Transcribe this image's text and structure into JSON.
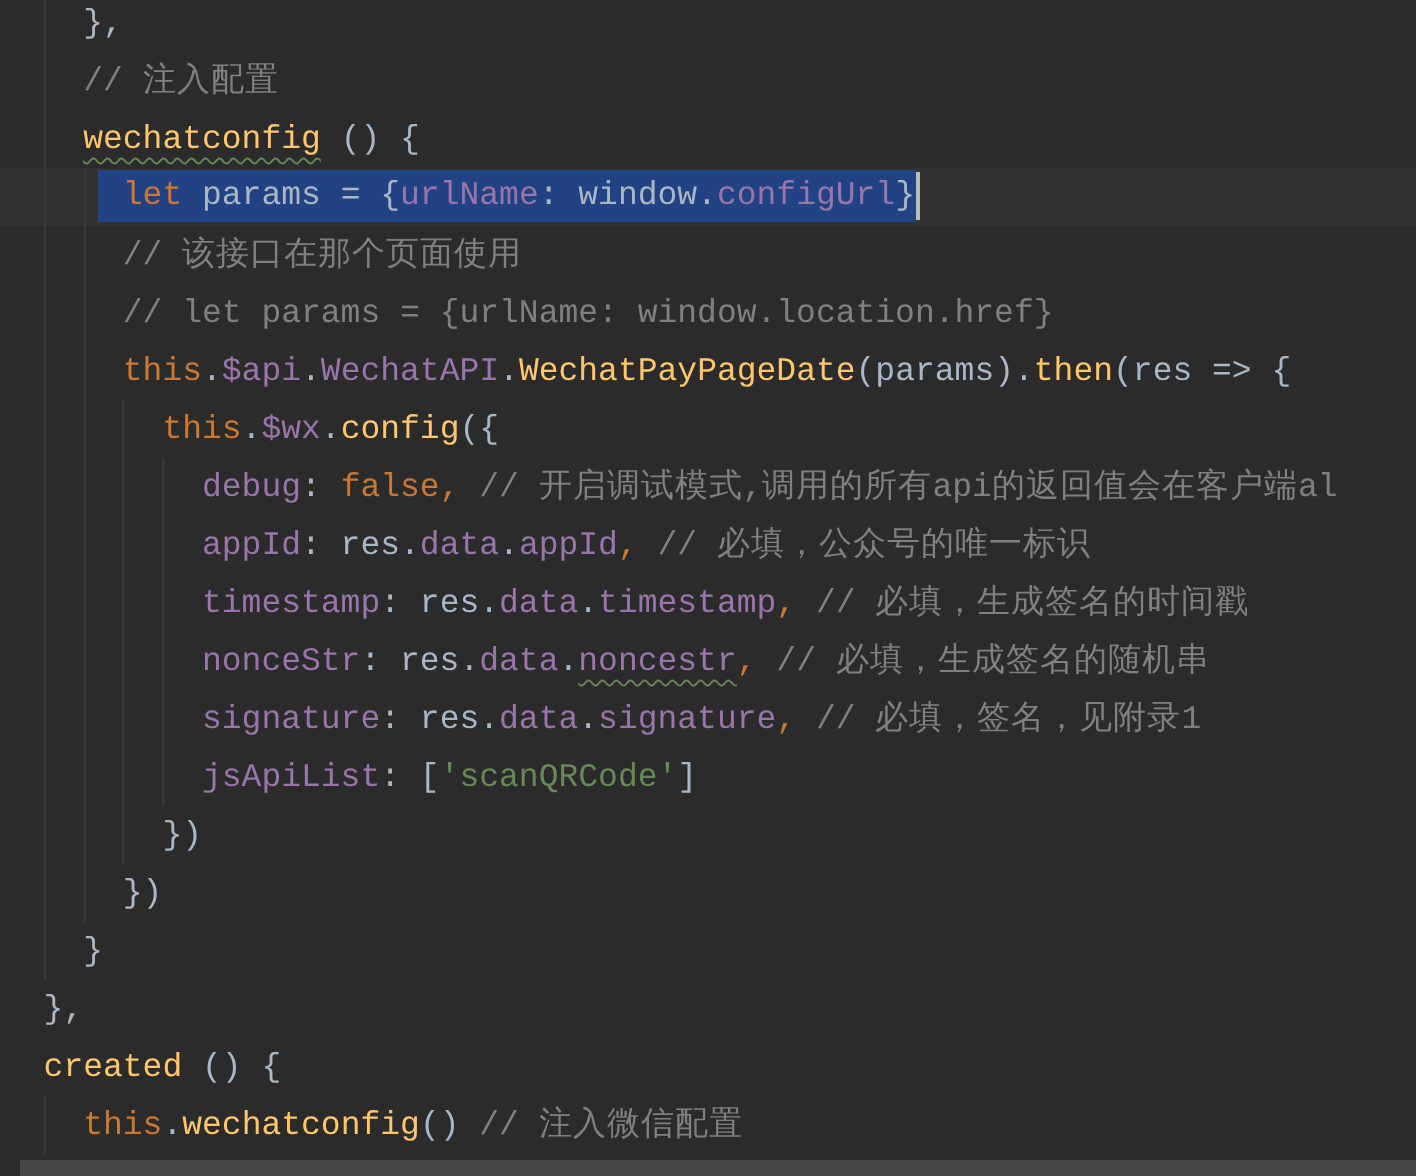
{
  "editor": {
    "lines": [
      {
        "children": [
          {
            "current": false,
            "selected": false,
            "tokens": [
              {
                "text": "},",
                "kind": "plain"
              }
            ]
          },
          {
            "current": false,
            "selected": false,
            "tokens": [
              {
                "text": "// 注入配置",
                "kind": "comment"
              }
            ]
          },
          {
            "current": false,
            "selected": false,
            "tokens": [
              {
                "text": "wechatconfig",
                "kind": "method",
                "misspelled": true
              },
              {
                "text": " () {",
                "kind": "plain"
              }
            ],
            "children": [
              {
                "current": true,
                "selected": true,
                "tokens": [
                  {
                    "text": "let",
                    "kind": "keyword"
                  },
                  {
                    "text": " params = {",
                    "kind": "plain"
                  },
                  {
                    "text": "urlName",
                    "kind": "property"
                  },
                  {
                    "text": ": window.",
                    "kind": "plain"
                  },
                  {
                    "text": "configUrl",
                    "kind": "property"
                  },
                  {
                    "text": "}",
                    "kind": "plain"
                  }
                ]
              },
              {
                "current": false,
                "selected": false,
                "tokens": [
                  {
                    "text": "// 该接口在那个页面使用",
                    "kind": "comment"
                  }
                ]
              },
              {
                "current": false,
                "selected": false,
                "tokens": [
                  {
                    "text": "// let params = {urlName: window.location.href}",
                    "kind": "comment"
                  }
                ]
              },
              {
                "current": false,
                "selected": false,
                "tokens": [
                  {
                    "text": "this",
                    "kind": "keyword"
                  },
                  {
                    "text": ".",
                    "kind": "plain"
                  },
                  {
                    "text": "$api",
                    "kind": "property"
                  },
                  {
                    "text": ".",
                    "kind": "plain"
                  },
                  {
                    "text": "WechatAPI",
                    "kind": "property"
                  },
                  {
                    "text": ".",
                    "kind": "plain"
                  },
                  {
                    "text": "WechatPayPageDate",
                    "kind": "method"
                  },
                  {
                    "text": "(params).",
                    "kind": "plain"
                  },
                  {
                    "text": "then",
                    "kind": "method"
                  },
                  {
                    "text": "(res => {",
                    "kind": "plain"
                  }
                ],
                "children": [
                  {
                    "current": false,
                    "selected": false,
                    "tokens": [
                      {
                        "text": "this",
                        "kind": "keyword"
                      },
                      {
                        "text": ".",
                        "kind": "plain"
                      },
                      {
                        "text": "$wx",
                        "kind": "property"
                      },
                      {
                        "text": ".",
                        "kind": "plain"
                      },
                      {
                        "text": "config",
                        "kind": "method"
                      },
                      {
                        "text": "({",
                        "kind": "plain"
                      }
                    ],
                    "children": [
                      {
                        "current": false,
                        "selected": false,
                        "tokens": [
                          {
                            "text": "debug",
                            "kind": "property"
                          },
                          {
                            "text": ": ",
                            "kind": "plain"
                          },
                          {
                            "text": "false",
                            "kind": "keyword"
                          },
                          {
                            "text": ", ",
                            "kind": "keyword"
                          },
                          {
                            "text": "// 开启调试模式,调用的所有api的返回值会在客户端al",
                            "kind": "comment"
                          }
                        ]
                      },
                      {
                        "current": false,
                        "selected": false,
                        "tokens": [
                          {
                            "text": "appId",
                            "kind": "property"
                          },
                          {
                            "text": ": res.",
                            "kind": "plain"
                          },
                          {
                            "text": "data",
                            "kind": "property"
                          },
                          {
                            "text": ".",
                            "kind": "plain"
                          },
                          {
                            "text": "appId",
                            "kind": "property"
                          },
                          {
                            "text": ", ",
                            "kind": "keyword"
                          },
                          {
                            "text": "// 必填，公众号的唯一标识",
                            "kind": "comment"
                          }
                        ]
                      },
                      {
                        "current": false,
                        "selected": false,
                        "tokens": [
                          {
                            "text": "timestamp",
                            "kind": "property"
                          },
                          {
                            "text": ": res.",
                            "kind": "plain"
                          },
                          {
                            "text": "data",
                            "kind": "property"
                          },
                          {
                            "text": ".",
                            "kind": "plain"
                          },
                          {
                            "text": "timestamp",
                            "kind": "property"
                          },
                          {
                            "text": ", ",
                            "kind": "keyword"
                          },
                          {
                            "text": "// 必填，生成签名的时间戳",
                            "kind": "comment"
                          }
                        ]
                      },
                      {
                        "current": false,
                        "selected": false,
                        "tokens": [
                          {
                            "text": "nonceStr",
                            "kind": "property"
                          },
                          {
                            "text": ": res.",
                            "kind": "plain"
                          },
                          {
                            "text": "data",
                            "kind": "property"
                          },
                          {
                            "text": ".",
                            "kind": "plain"
                          },
                          {
                            "text": "noncestr",
                            "kind": "property",
                            "misspelled": true
                          },
                          {
                            "text": ", ",
                            "kind": "keyword"
                          },
                          {
                            "text": "// 必填，生成签名的随机串",
                            "kind": "comment"
                          }
                        ]
                      },
                      {
                        "current": false,
                        "selected": false,
                        "tokens": [
                          {
                            "text": "signature",
                            "kind": "property"
                          },
                          {
                            "text": ": res.",
                            "kind": "plain"
                          },
                          {
                            "text": "data",
                            "kind": "property"
                          },
                          {
                            "text": ".",
                            "kind": "plain"
                          },
                          {
                            "text": "signature",
                            "kind": "property"
                          },
                          {
                            "text": ", ",
                            "kind": "keyword"
                          },
                          {
                            "text": "// 必填，签名，见附录1",
                            "kind": "comment"
                          }
                        ]
                      },
                      {
                        "current": false,
                        "selected": false,
                        "tokens": [
                          {
                            "text": "jsApiList",
                            "kind": "property"
                          },
                          {
                            "text": ": [",
                            "kind": "plain"
                          },
                          {
                            "text": "'scanQRCode'",
                            "kind": "string"
                          },
                          {
                            "text": "]",
                            "kind": "plain"
                          }
                        ]
                      }
                    ]
                  },
                  {
                    "current": false,
                    "selected": false,
                    "tokens": [
                      {
                        "text": "})",
                        "kind": "plain"
                      }
                    ]
                  }
                ]
              },
              {
                "current": false,
                "selected": false,
                "tokens": [
                  {
                    "text": "})",
                    "kind": "plain"
                  }
                ]
              }
            ]
          },
          {
            "current": false,
            "selected": false,
            "tokens": [
              {
                "text": "}",
                "kind": "plain"
              }
            ]
          }
        ]
      },
      {
        "current": false,
        "selected": false,
        "tokens": [
          {
            "text": "},",
            "kind": "plain"
          }
        ]
      },
      {
        "current": false,
        "selected": false,
        "tokens": [
          {
            "text": "created",
            "kind": "method"
          },
          {
            "text": " () {",
            "kind": "plain"
          }
        ],
        "children": [
          {
            "current": false,
            "selected": false,
            "tokens": [
              {
                "text": "this",
                "kind": "keyword"
              },
              {
                "text": ".",
                "kind": "plain"
              },
              {
                "text": "wechatconfig",
                "kind": "method"
              },
              {
                "text": "()",
                "kind": "plain"
              },
              {
                "text": " // 注入微信配置",
                "kind": "comment"
              }
            ]
          }
        ]
      }
    ]
  }
}
